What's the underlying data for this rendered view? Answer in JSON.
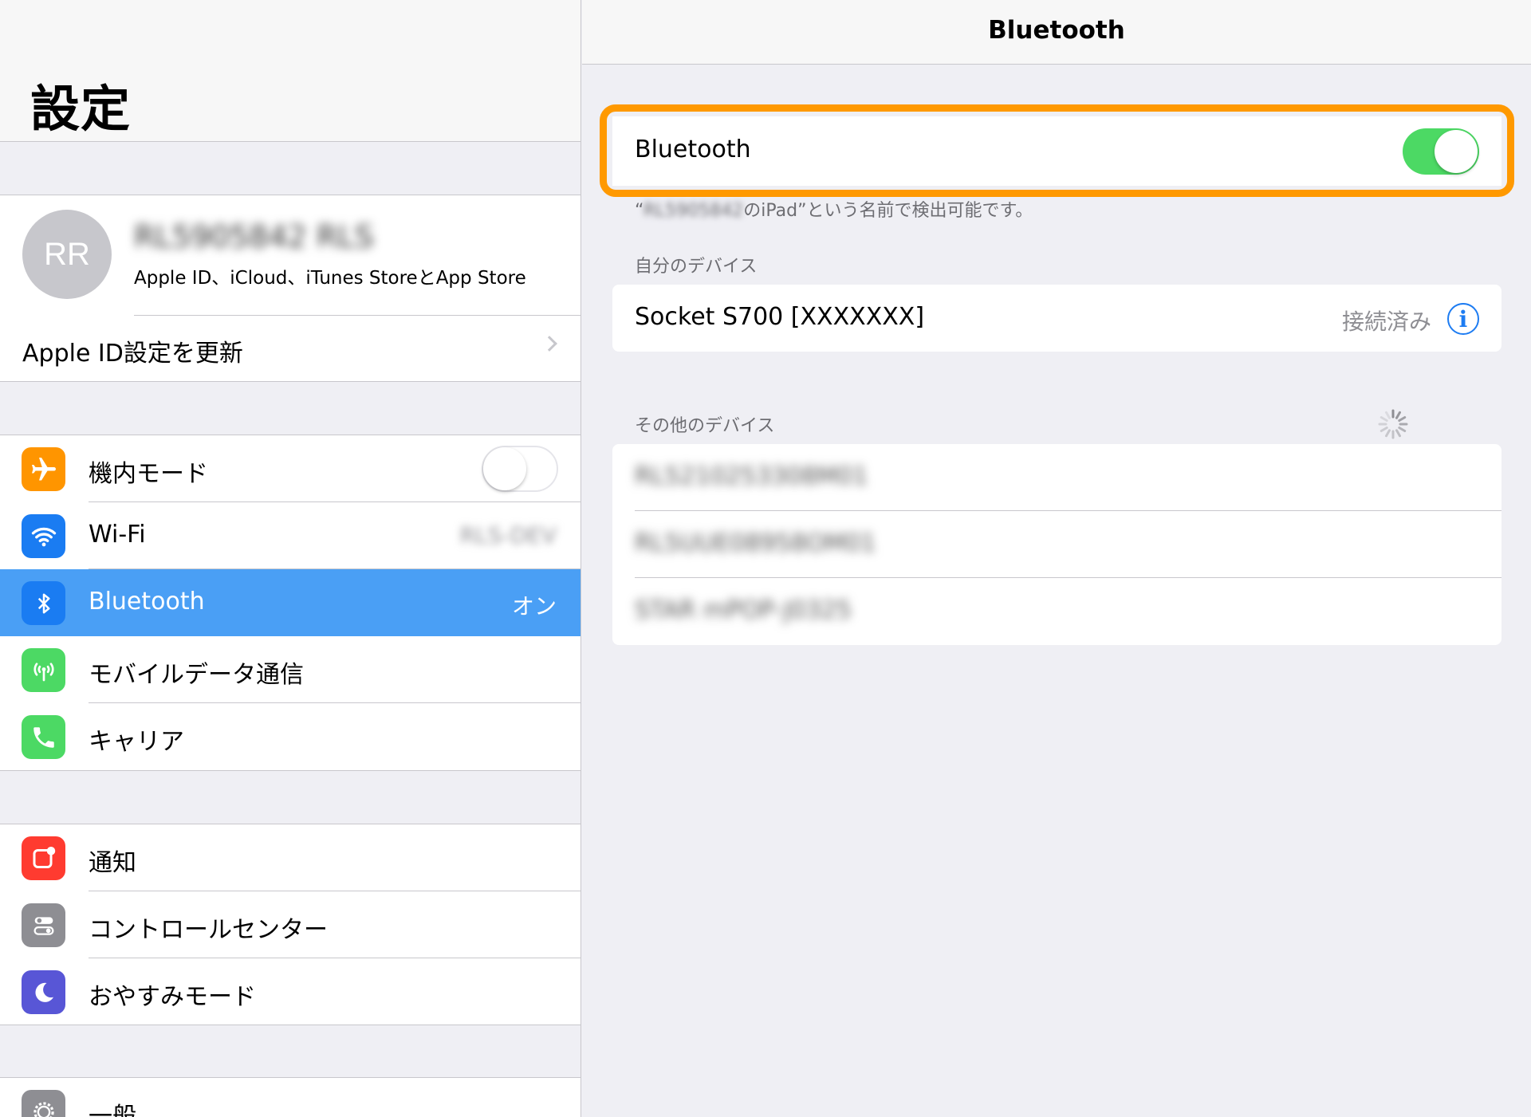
{
  "sidebar": {
    "title": "設定",
    "profile": {
      "initials": "RR",
      "name": "RL5905842 RLS",
      "subtitle": "Apple ID、iCloud、iTunes StoreとApp Store",
      "update_label": "Apple ID設定を更新"
    },
    "connectivity": [
      {
        "label": "機内モード",
        "value": "",
        "icon": "airplane-icon",
        "color": "#ff9500",
        "toggle": "off"
      },
      {
        "label": "Wi-Fi",
        "value": "RLS-DEV",
        "icon": "wifi-icon",
        "color": "#1a7cf2"
      },
      {
        "label": "Bluetooth",
        "value": "オン",
        "icon": "bluetooth-icon",
        "color": "#1a7cf2",
        "selected": true
      },
      {
        "label": "モバイルデータ通信",
        "value": "",
        "icon": "cellular-antenna-icon",
        "color": "#4cd964"
      },
      {
        "label": "キャリア",
        "value": "",
        "icon": "phone-icon",
        "color": "#4cd964"
      }
    ],
    "notifications": [
      {
        "label": "通知",
        "icon": "notifications-icon",
        "color": "#ff3b30"
      },
      {
        "label": "コントロールセンター",
        "icon": "control-center-icon",
        "color": "#8e8e93"
      },
      {
        "label": "おやすみモード",
        "icon": "moon-icon",
        "color": "#5856d6"
      }
    ],
    "general": {
      "label": "一般",
      "icon": "gear-icon",
      "color": "#8e8e93"
    }
  },
  "detail": {
    "nav_title": "Bluetooth",
    "bluetooth_toggle": {
      "label": "Bluetooth",
      "state": "on"
    },
    "discoverable_name": "RL5905842",
    "discoverable_suffix": "のiPad”という名前で検出可能です。",
    "my_devices_header": "自分のデバイス",
    "my_devices": [
      {
        "name": "Socket S700 [XXXXXXX]",
        "status": "接続済み"
      }
    ],
    "other_devices_header": "その他のデバイス",
    "other_devices": [
      {
        "name": "RL5210253308M01"
      },
      {
        "name": "RL5UUE08958OM01"
      },
      {
        "name": "STAR mPOP-J0325"
      }
    ]
  },
  "colors": {
    "highlight": "#ff9900",
    "toggle_on": "#4cd964",
    "selection": "#4a9ff5",
    "link": "#1d7cf2"
  }
}
